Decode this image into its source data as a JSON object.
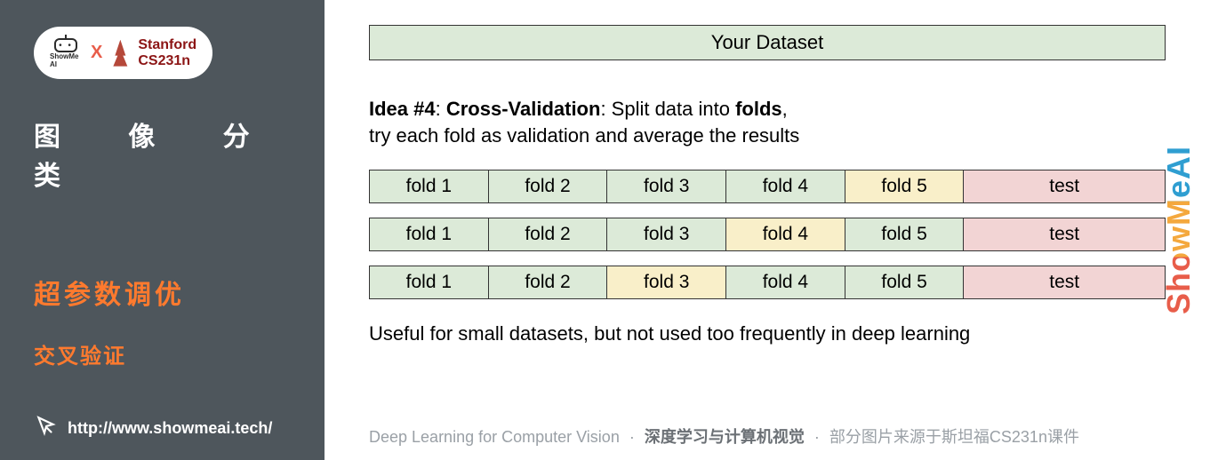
{
  "sidebar": {
    "logo": {
      "showme_label": "ShowMe AI",
      "separator": "X",
      "stanford_line1": "Stanford",
      "stanford_line2": "CS231n"
    },
    "topic": "图 像 分 类",
    "title_orange": "超参数调优",
    "subtitle_orange": "交叉验证",
    "url": "http://www.showmeai.tech/"
  },
  "main": {
    "watermark": "ShowMeAI",
    "dataset_bar": "Your Dataset",
    "idea_strong1": "Idea #4",
    "idea_colon1": ": ",
    "idea_strong2": "Cross-Validation",
    "idea_mid": ": Split data into ",
    "idea_strong3": "folds",
    "idea_tail": ",",
    "idea_line2": "try each fold as validation and average the results",
    "folds": {
      "row1": [
        {
          "label": "fold 1",
          "c": "green"
        },
        {
          "label": "fold 2",
          "c": "green"
        },
        {
          "label": "fold 3",
          "c": "green"
        },
        {
          "label": "fold 4",
          "c": "green"
        },
        {
          "label": "fold 5",
          "c": "yellow"
        },
        {
          "label": "test",
          "c": "pink",
          "test": true
        }
      ],
      "row2": [
        {
          "label": "fold 1",
          "c": "green"
        },
        {
          "label": "fold 2",
          "c": "green"
        },
        {
          "label": "fold 3",
          "c": "green"
        },
        {
          "label": "fold 4",
          "c": "yellow"
        },
        {
          "label": "fold 5",
          "c": "green"
        },
        {
          "label": "test",
          "c": "pink",
          "test": true
        }
      ],
      "row3": [
        {
          "label": "fold 1",
          "c": "green"
        },
        {
          "label": "fold 2",
          "c": "green"
        },
        {
          "label": "fold 3",
          "c": "yellow"
        },
        {
          "label": "fold 4",
          "c": "green"
        },
        {
          "label": "fold 5",
          "c": "green"
        },
        {
          "label": "test",
          "c": "pink",
          "test": true
        }
      ]
    },
    "bottom_note": "Useful for small datasets, but not used too frequently in deep learning",
    "footer": {
      "part1": "Deep Learning for Computer Vision",
      "dot": "·",
      "part2": "深度学习与计算机视觉",
      "part3": "部分图片来源于斯坦福CS231n课件"
    }
  }
}
